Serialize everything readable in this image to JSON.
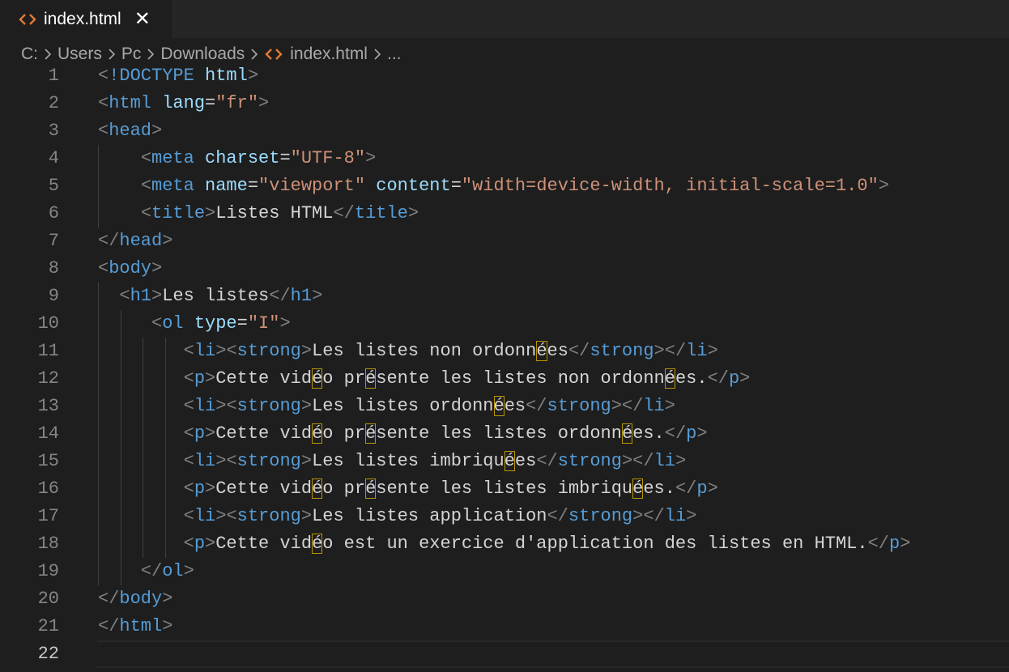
{
  "tab": {
    "label": "index.html",
    "close_glyph": "✕",
    "icon": "html-file-icon"
  },
  "breadcrumb": {
    "items": [
      "C:",
      "Users",
      "Pc",
      "Downloads",
      "index.html",
      "..."
    ],
    "icon": "html-file-icon"
  },
  "editor": {
    "active_line": 22,
    "lines": [
      {
        "n": "1",
        "tokens": [
          [
            "p",
            "<"
          ],
          [
            "t",
            "!DOCTYPE"
          ],
          [
            "x",
            " "
          ],
          [
            "a",
            "html"
          ],
          [
            "p",
            ">"
          ]
        ]
      },
      {
        "n": "2",
        "tokens": [
          [
            "p",
            "<"
          ],
          [
            "t",
            "html"
          ],
          [
            "x",
            " "
          ],
          [
            "a",
            "lang"
          ],
          [
            "x",
            "="
          ],
          [
            "s",
            "\"fr\""
          ],
          [
            "p",
            ">"
          ]
        ]
      },
      {
        "n": "3",
        "tokens": [
          [
            "p",
            "<"
          ],
          [
            "t",
            "head"
          ],
          [
            "p",
            ">"
          ]
        ]
      },
      {
        "n": "4",
        "indent": "    ",
        "tokens": [
          [
            "p",
            "<"
          ],
          [
            "t",
            "meta"
          ],
          [
            "x",
            " "
          ],
          [
            "a",
            "charset"
          ],
          [
            "x",
            "="
          ],
          [
            "s",
            "\"UTF-8\""
          ],
          [
            "p",
            ">"
          ]
        ]
      },
      {
        "n": "5",
        "indent": "    ",
        "tokens": [
          [
            "p",
            "<"
          ],
          [
            "t",
            "meta"
          ],
          [
            "x",
            " "
          ],
          [
            "a",
            "name"
          ],
          [
            "x",
            "="
          ],
          [
            "s",
            "\"viewport\""
          ],
          [
            "x",
            " "
          ],
          [
            "a",
            "content"
          ],
          [
            "x",
            "="
          ],
          [
            "s",
            "\"width=device-width, initial-scale=1.0\""
          ],
          [
            "p",
            ">"
          ]
        ]
      },
      {
        "n": "6",
        "indent": "    ",
        "tokens": [
          [
            "p",
            "<"
          ],
          [
            "t",
            "title"
          ],
          [
            "p",
            ">"
          ],
          [
            "x",
            "Listes HTML"
          ],
          [
            "p",
            "</"
          ],
          [
            "t",
            "title"
          ],
          [
            "p",
            ">"
          ]
        ]
      },
      {
        "n": "7",
        "tokens": [
          [
            "p",
            "</"
          ],
          [
            "t",
            "head"
          ],
          [
            "p",
            ">"
          ]
        ]
      },
      {
        "n": "8",
        "tokens": [
          [
            "p",
            "<"
          ],
          [
            "t",
            "body"
          ],
          [
            "p",
            ">"
          ]
        ]
      },
      {
        "n": "9",
        "indent": "  ",
        "tokens": [
          [
            "p",
            "<"
          ],
          [
            "t",
            "h1"
          ],
          [
            "p",
            ">"
          ],
          [
            "x",
            "Les listes"
          ],
          [
            "p",
            "</"
          ],
          [
            "t",
            "h1"
          ],
          [
            "p",
            ">"
          ]
        ]
      },
      {
        "n": "10",
        "indent": "     ",
        "tokens": [
          [
            "p",
            "<"
          ],
          [
            "t",
            "ol"
          ],
          [
            "x",
            " "
          ],
          [
            "a",
            "type"
          ],
          [
            "x",
            "="
          ],
          [
            "s",
            "\"I\""
          ],
          [
            "p",
            ">"
          ]
        ]
      },
      {
        "n": "11",
        "indent": "        ",
        "tokens": [
          [
            "p",
            "<"
          ],
          [
            "t",
            "li"
          ],
          [
            "p",
            "><"
          ],
          [
            "t",
            "strong"
          ],
          [
            "p",
            ">"
          ],
          [
            "x",
            "Les listes non ordonn"
          ],
          [
            "u",
            "é"
          ],
          [
            "x",
            "es"
          ],
          [
            "p",
            "</"
          ],
          [
            "t",
            "strong"
          ],
          [
            "p",
            "></"
          ],
          [
            "t",
            "li"
          ],
          [
            "p",
            ">"
          ]
        ]
      },
      {
        "n": "12",
        "indent": "        ",
        "tokens": [
          [
            "p",
            "<"
          ],
          [
            "t",
            "p"
          ],
          [
            "p",
            ">"
          ],
          [
            "x",
            "Cette vid"
          ],
          [
            "u",
            "é"
          ],
          [
            "x",
            "o pr"
          ],
          [
            "u",
            "é"
          ],
          [
            "x",
            "sente les listes non ordonn"
          ],
          [
            "u",
            "é"
          ],
          [
            "x",
            "es."
          ],
          [
            "p",
            "</"
          ],
          [
            "t",
            "p"
          ],
          [
            "p",
            ">"
          ]
        ]
      },
      {
        "n": "13",
        "indent": "        ",
        "tokens": [
          [
            "p",
            "<"
          ],
          [
            "t",
            "li"
          ],
          [
            "p",
            "><"
          ],
          [
            "t",
            "strong"
          ],
          [
            "p",
            ">"
          ],
          [
            "x",
            "Les listes ordonn"
          ],
          [
            "u",
            "é"
          ],
          [
            "x",
            "es"
          ],
          [
            "p",
            "</"
          ],
          [
            "t",
            "strong"
          ],
          [
            "p",
            "></"
          ],
          [
            "t",
            "li"
          ],
          [
            "p",
            ">"
          ]
        ]
      },
      {
        "n": "14",
        "indent": "        ",
        "tokens": [
          [
            "p",
            "<"
          ],
          [
            "t",
            "p"
          ],
          [
            "p",
            ">"
          ],
          [
            "x",
            "Cette vid"
          ],
          [
            "u",
            "é"
          ],
          [
            "x",
            "o pr"
          ],
          [
            "u",
            "é"
          ],
          [
            "x",
            "sente les listes ordonn"
          ],
          [
            "u",
            "é"
          ],
          [
            "x",
            "es."
          ],
          [
            "p",
            "</"
          ],
          [
            "t",
            "p"
          ],
          [
            "p",
            ">"
          ]
        ]
      },
      {
        "n": "15",
        "indent": "        ",
        "tokens": [
          [
            "p",
            "<"
          ],
          [
            "t",
            "li"
          ],
          [
            "p",
            "><"
          ],
          [
            "t",
            "strong"
          ],
          [
            "p",
            ">"
          ],
          [
            "x",
            "Les listes imbriqu"
          ],
          [
            "u",
            "é"
          ],
          [
            "x",
            "es"
          ],
          [
            "p",
            "</"
          ],
          [
            "t",
            "strong"
          ],
          [
            "p",
            "></"
          ],
          [
            "t",
            "li"
          ],
          [
            "p",
            ">"
          ]
        ]
      },
      {
        "n": "16",
        "indent": "        ",
        "tokens": [
          [
            "p",
            "<"
          ],
          [
            "t",
            "p"
          ],
          [
            "p",
            ">"
          ],
          [
            "x",
            "Cette vid"
          ],
          [
            "u",
            "é"
          ],
          [
            "x",
            "o pr"
          ],
          [
            "u",
            "é"
          ],
          [
            "x",
            "sente les listes imbriqu"
          ],
          [
            "u",
            "é"
          ],
          [
            "x",
            "es."
          ],
          [
            "p",
            "</"
          ],
          [
            "t",
            "p"
          ],
          [
            "p",
            ">"
          ]
        ]
      },
      {
        "n": "17",
        "indent": "        ",
        "tokens": [
          [
            "p",
            "<"
          ],
          [
            "t",
            "li"
          ],
          [
            "p",
            "><"
          ],
          [
            "t",
            "strong"
          ],
          [
            "p",
            ">"
          ],
          [
            "x",
            "Les listes application"
          ],
          [
            "p",
            "</"
          ],
          [
            "t",
            "strong"
          ],
          [
            "p",
            "></"
          ],
          [
            "t",
            "li"
          ],
          [
            "p",
            ">"
          ]
        ]
      },
      {
        "n": "18",
        "indent": "        ",
        "tokens": [
          [
            "p",
            "<"
          ],
          [
            "t",
            "p"
          ],
          [
            "p",
            ">"
          ],
          [
            "x",
            "Cette vid"
          ],
          [
            "u",
            "é"
          ],
          [
            "x",
            "o est un exercice d'application des listes en HTML."
          ],
          [
            "p",
            "</"
          ],
          [
            "t",
            "p"
          ],
          [
            "p",
            ">"
          ]
        ]
      },
      {
        "n": "19",
        "indent": "    ",
        "tokens": [
          [
            "p",
            "</"
          ],
          [
            "t",
            "ol"
          ],
          [
            "p",
            ">"
          ]
        ]
      },
      {
        "n": "20",
        "tokens": [
          [
            "p",
            "</"
          ],
          [
            "t",
            "body"
          ],
          [
            "p",
            ">"
          ]
        ]
      },
      {
        "n": "21",
        "tokens": [
          [
            "p",
            "</"
          ],
          [
            "t",
            "html"
          ],
          [
            "p",
            ">"
          ]
        ]
      },
      {
        "n": "22",
        "tokens": []
      }
    ]
  },
  "colors": {
    "background": "#1e1e1e",
    "tag": "#569cd6",
    "attribute": "#9cdcfe",
    "string": "#ce9178",
    "punctuation": "#808080",
    "text": "#d4d4d4",
    "html_icon": "#e37933",
    "unicode_highlight": "#b89500"
  }
}
